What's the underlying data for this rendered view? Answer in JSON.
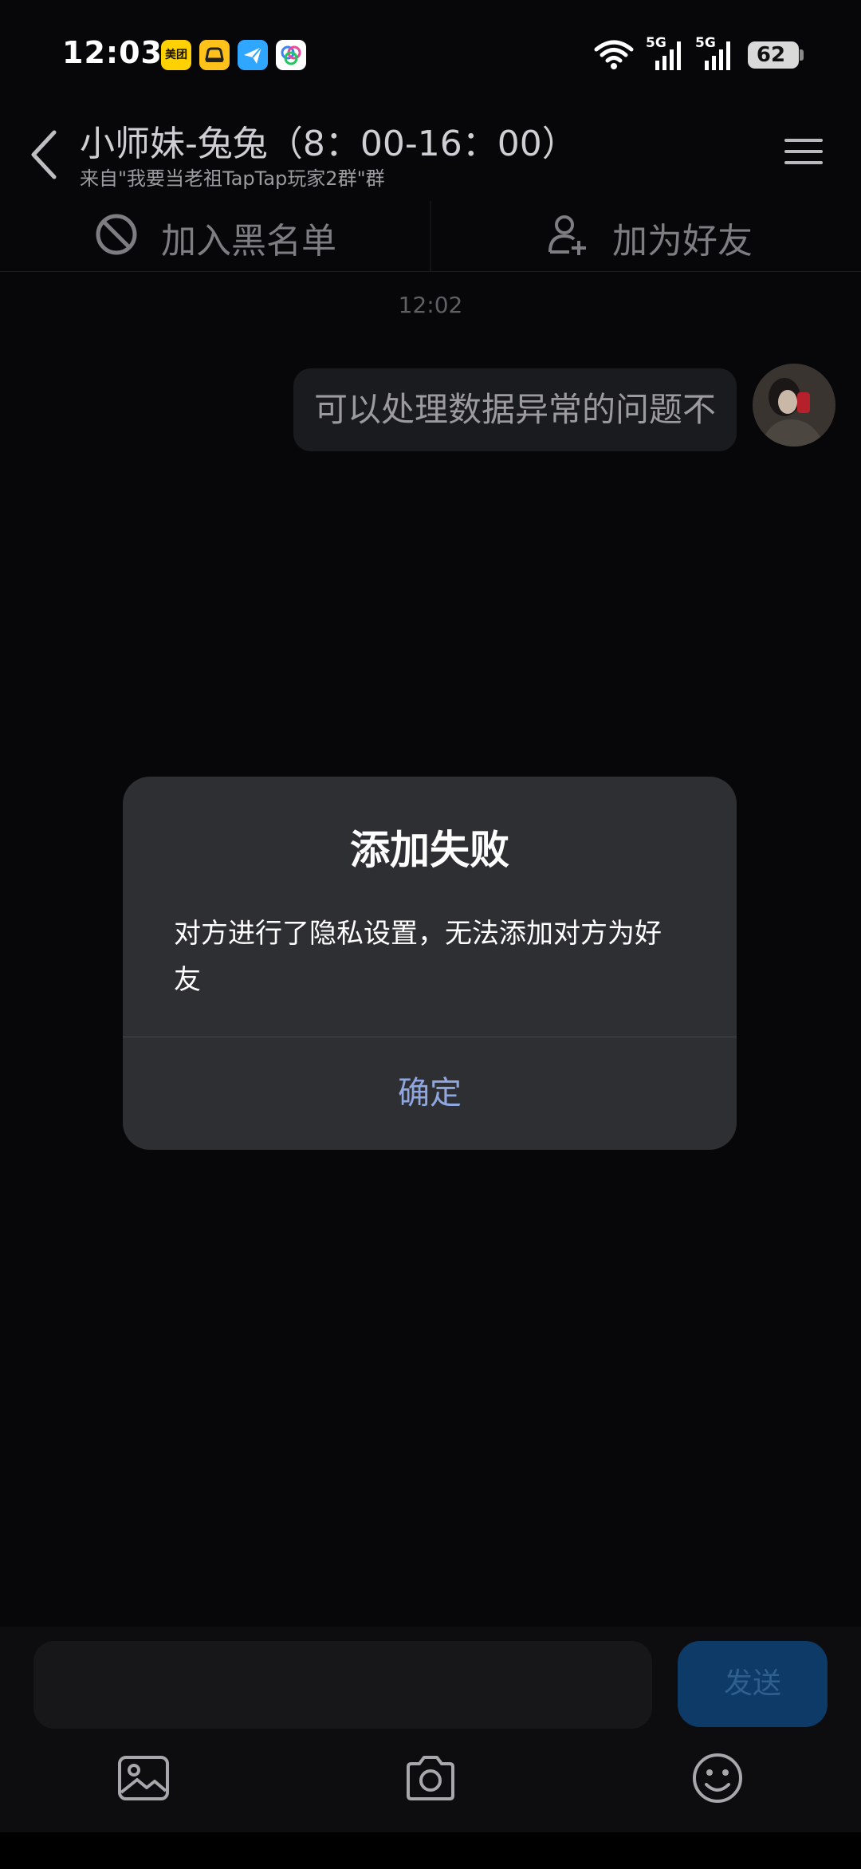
{
  "status_bar": {
    "time": "12:03",
    "app_icons": [
      "meituan-icon",
      "car-icon",
      "plane-icon",
      "photos-icon"
    ],
    "meituan_label": "美团",
    "network": [
      "5G",
      "5G"
    ],
    "battery": "62"
  },
  "header": {
    "title": "小师妹-兔兔（8：00-16：00）",
    "subtitle": "来自\"我要当老祖TapTap玩家2群\"群"
  },
  "actions": {
    "block_label": "加入黑名单",
    "add_friend_label": "加为好友"
  },
  "chat": {
    "timestamp": "12:02",
    "messages": [
      {
        "from": "self",
        "text": "可以处理数据异常的问题不"
      }
    ]
  },
  "dialog": {
    "title": "添加失败",
    "message": "对方进行了隐私设置，无法添加对方为好友",
    "confirm_label": "确定"
  },
  "composer": {
    "input_value": "",
    "send_label": "发送",
    "tools": [
      "image-icon",
      "camera-icon",
      "emoji-icon"
    ]
  },
  "colors": {
    "background": "#070709",
    "dialog_bg": "#2e2f33",
    "accent": "#8fa6e0",
    "send_bg": "#0d3a66"
  }
}
